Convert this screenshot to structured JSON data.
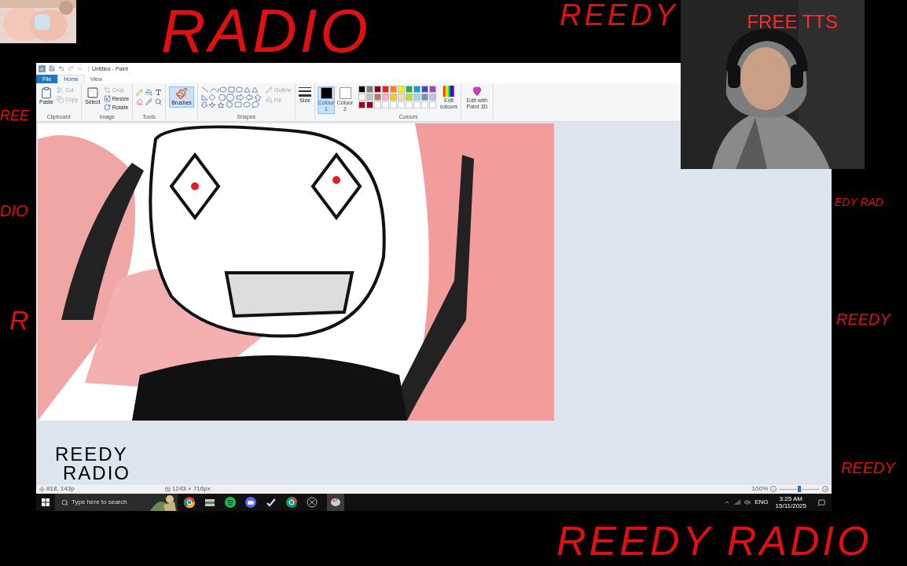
{
  "backdrop_texts": [
    {
      "text": "RADIO"
    },
    {
      "text": "REEDY"
    },
    {
      "text": "REE"
    },
    {
      "text": "DIO"
    },
    {
      "text": "R"
    },
    {
      "text": "EDY RAD"
    },
    {
      "text": "REEDY"
    },
    {
      "text": "REEDY"
    },
    {
      "text": "REEDY RADIO"
    }
  ],
  "webcam": {
    "caption": "FREE TTS"
  },
  "paint": {
    "title": "Untitled - Paint",
    "tabs": [
      {
        "label": "File",
        "kind": "file",
        "selected": false
      },
      {
        "label": "Home",
        "kind": "tab",
        "selected": true
      },
      {
        "label": "View",
        "kind": "tab",
        "selected": false
      }
    ],
    "clipboard": {
      "label": "Clipboard",
      "paste": "Paste",
      "cut": {
        "label": "Cut",
        "disabled": true
      },
      "copy": {
        "label": "Copy",
        "disabled": true
      }
    },
    "image": {
      "label": "Image",
      "select": "Select",
      "crop": {
        "label": "Crop",
        "disabled": true
      },
      "resize": "Resize",
      "rotate": "Rotate"
    },
    "tools": {
      "label": "Tools"
    },
    "brushes": {
      "label": "Brushes",
      "selected": true
    },
    "shapes": {
      "label": "Shapes",
      "outline": {
        "label": "Outline",
        "disabled": true
      },
      "fill": {
        "label": "Fill",
        "disabled": true
      }
    },
    "size": "Size",
    "colour_slots": [
      {
        "label": "Colour 1",
        "color": "#000000",
        "selected": true
      },
      {
        "label": "Colour 2",
        "color": "#ffffff",
        "selected": false
      }
    ],
    "palette": [
      {
        "color": "#000000"
      },
      {
        "color": "#7f7f7f"
      },
      {
        "color": "#880015"
      },
      {
        "color": "#ed1c24"
      },
      {
        "color": "#ff7f27"
      },
      {
        "color": "#fff200"
      },
      {
        "color": "#22b14c"
      },
      {
        "color": "#00a2e8"
      },
      {
        "color": "#3f48cc"
      },
      {
        "color": "#a349a4"
      },
      {
        "color": "#ffffff"
      },
      {
        "color": "#c3c3c3"
      },
      {
        "color": "#b97a57"
      },
      {
        "color": "#ffaec9"
      },
      {
        "color": "#ffc90e"
      },
      {
        "color": "#efe4b0"
      },
      {
        "color": "#b5e61d"
      },
      {
        "color": "#99d9ea"
      },
      {
        "color": "#7092be"
      },
      {
        "color": "#c8bfe7"
      },
      {
        "color": "#a0001c"
      },
      {
        "color": "#900020"
      }
    ],
    "colours_label": "Colours",
    "edit_colours": "Edit colours",
    "paint_3d": "Edit with Paint 3D",
    "handwriting": [
      "REEDY",
      "RADIO"
    ],
    "status": {
      "cursor": "818, 143p",
      "canvas_size": "1243 × 716px",
      "zoom": "100%",
      "zoom_slider": {
        "level": 0.5
      }
    }
  },
  "taskbar": {
    "search_placeholder": "Type here to search",
    "language": "ENG",
    "time": "3:25 AM",
    "date": "15/11/2025"
  }
}
